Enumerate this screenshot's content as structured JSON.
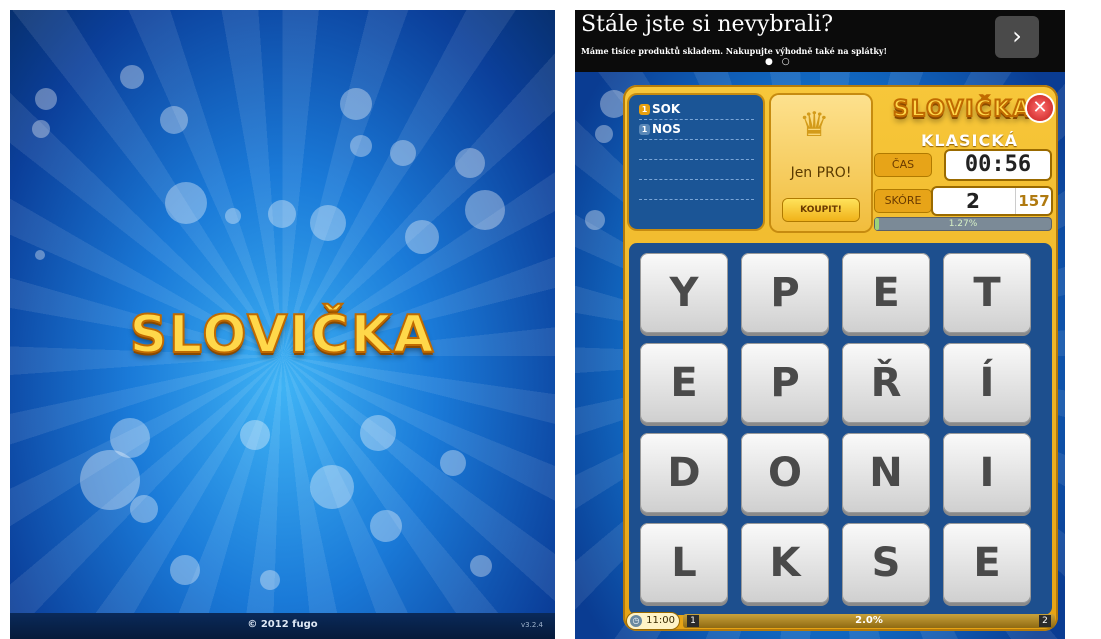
{
  "splash": {
    "logo": "SLOVIČKA",
    "copyright": "© 2012 fugo",
    "version": "v3.2.4"
  },
  "ad": {
    "title": "Stále jste si nevybrali?",
    "subtitle": "Máme tisíce produktů skladem. Nakupujte výhodně také na splátky!",
    "dots": "● ○",
    "next_glyph": "›"
  },
  "game": {
    "logo": "SLOVIČKA",
    "mode": "KLASICKÁ",
    "words": [
      {
        "count": "1",
        "text": "SOK",
        "badge_color": "#e8a010"
      },
      {
        "count": "1",
        "text": "NOS",
        "badge_color": "#5a88b8"
      }
    ],
    "pro_label": "Jen PRO!",
    "buy_label": "KOUPIT!",
    "time_label": "ČAS",
    "time_value": "00:56",
    "score_label": "SKÓRE",
    "score_value": "2",
    "best_value": "157",
    "progress_text": "1.27%",
    "progress_fraction": 0.0127,
    "close_glyph": "✕",
    "tiles": [
      [
        "Y",
        "P",
        "E",
        "T"
      ],
      [
        "E",
        "P",
        "Ř",
        "Í"
      ],
      [
        "D",
        "O",
        "N",
        "I"
      ],
      [
        "L",
        "K",
        "S",
        "E"
      ]
    ],
    "bottom": {
      "time": "11:00",
      "left_badge": "1",
      "percent": "2.0%",
      "right_badge": "2"
    }
  },
  "colors": {
    "accent": "#f1bd3c",
    "board_blue": "#1d4f8e"
  }
}
